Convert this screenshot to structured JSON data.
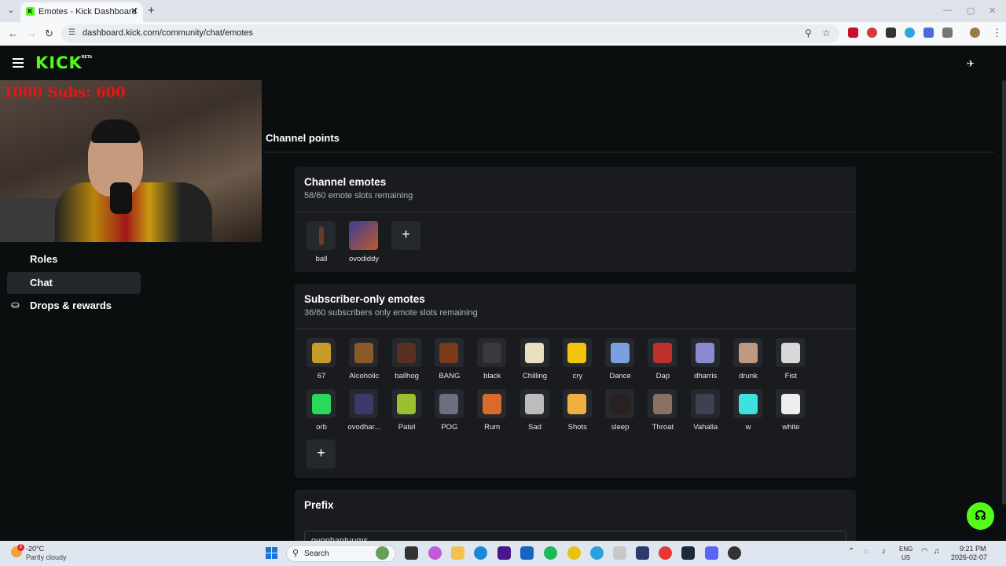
{
  "browser": {
    "tab_title": "Emotes - Kick Dashboard",
    "url": "dashboard.kick.com/community/chat/emotes"
  },
  "header": {
    "logo": "KICK",
    "beta": "BETA"
  },
  "webcam": {
    "overlay_text": "1000  Subs: 600"
  },
  "sidebar": {
    "items": [
      {
        "label": "Roles",
        "active": false,
        "icon": ""
      },
      {
        "label": "Chat",
        "active": true,
        "icon": ""
      },
      {
        "label": "Drops & rewards",
        "active": false,
        "icon": "rewards-icon"
      }
    ]
  },
  "main": {
    "tab": "Channel points",
    "channel_emotes": {
      "title": "Channel emotes",
      "subtitle": "58/60 emote slots remaining",
      "emotes": [
        "ball",
        "ovodiddy"
      ]
    },
    "subscriber_emotes": {
      "title": "Subscriber-only emotes",
      "subtitle": "36/60 subscribers only emote slots remaining",
      "emotes": [
        "67",
        "Alcoholic",
        "ballhog",
        "BANG",
        "black",
        "Chilling",
        "cry",
        "Dance",
        "Dap",
        "dharris",
        "drunk",
        "Fist",
        "orb",
        "ovodhar...",
        "Patel",
        "POG",
        "Rum",
        "Sad",
        "Shots",
        "sleep",
        "Throat",
        "Vahalla",
        "w",
        "white"
      ]
    },
    "prefix": {
      "title": "Prefix",
      "value": "ovophantuums"
    }
  },
  "taskbar": {
    "temp": "-20°C",
    "weather": "Partly cloudy",
    "weather_badge": "2",
    "search": "Search",
    "lang1": "ENG",
    "lang2": "US",
    "time": "9:21 PM",
    "date": "2026-02-07"
  },
  "colors": {
    "accent": "#53fc18",
    "card": "#191b1f",
    "bg": "#0b0e0f"
  }
}
